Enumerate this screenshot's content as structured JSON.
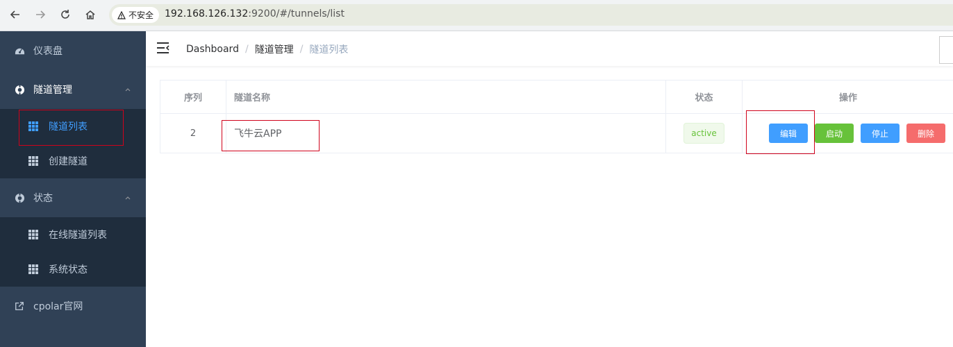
{
  "browser": {
    "security_label": "不安全",
    "url_host": "192.168.126.132",
    "url_path": ":9200/#/tunnels/list",
    "icons": [
      "back-icon",
      "forward-icon",
      "reload-icon",
      "home-icon",
      "warning-icon"
    ]
  },
  "sidebar": {
    "items": [
      {
        "label": "仪表盘",
        "icon": "dashboard-icon"
      },
      {
        "label": "隧道管理",
        "icon": "target-icon",
        "expanded": true
      },
      {
        "label": "隧道列表",
        "icon": "grid-icon",
        "active": true
      },
      {
        "label": "创建隧道",
        "icon": "grid-icon"
      },
      {
        "label": "状态",
        "icon": "target-icon",
        "expanded": true
      },
      {
        "label": "在线隧道列表",
        "icon": "grid-icon"
      },
      {
        "label": "系统状态",
        "icon": "grid-icon"
      },
      {
        "label": "cpolar官网",
        "icon": "external-link-icon"
      }
    ],
    "bg_color": "#304156",
    "sub_bg_color": "#1f2d3d",
    "active_color": "#409eff"
  },
  "breadcrumb": [
    "Dashboard",
    "隧道管理",
    "隧道列表"
  ],
  "table": {
    "columns": [
      "序列",
      "隧道名称",
      "状态",
      "操作"
    ],
    "rows": [
      {
        "index": "2",
        "name": "飞牛云APP",
        "status": "active"
      }
    ]
  },
  "actions": {
    "edit": "编辑",
    "start": "启动",
    "stop": "停止",
    "delete": "删除"
  },
  "colors": {
    "primary": "#409eff",
    "success": "#67c23a",
    "danger": "#f56c6c",
    "highlight_border": "#d0021b"
  }
}
